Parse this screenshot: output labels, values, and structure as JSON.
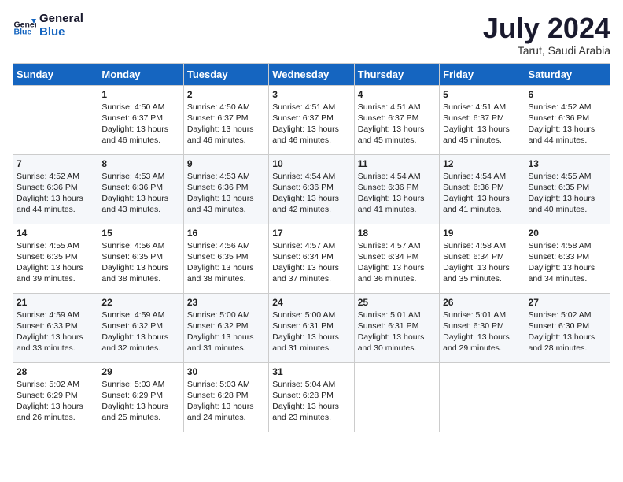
{
  "header": {
    "logo_line1": "General",
    "logo_line2": "Blue",
    "month": "July 2024",
    "location": "Tarut, Saudi Arabia"
  },
  "days_of_week": [
    "Sunday",
    "Monday",
    "Tuesday",
    "Wednesday",
    "Thursday",
    "Friday",
    "Saturday"
  ],
  "weeks": [
    [
      {
        "day": "",
        "content": ""
      },
      {
        "day": "1",
        "content": "Sunrise: 4:50 AM\nSunset: 6:37 PM\nDaylight: 13 hours\nand 46 minutes."
      },
      {
        "day": "2",
        "content": "Sunrise: 4:50 AM\nSunset: 6:37 PM\nDaylight: 13 hours\nand 46 minutes."
      },
      {
        "day": "3",
        "content": "Sunrise: 4:51 AM\nSunset: 6:37 PM\nDaylight: 13 hours\nand 46 minutes."
      },
      {
        "day": "4",
        "content": "Sunrise: 4:51 AM\nSunset: 6:37 PM\nDaylight: 13 hours\nand 45 minutes."
      },
      {
        "day": "5",
        "content": "Sunrise: 4:51 AM\nSunset: 6:37 PM\nDaylight: 13 hours\nand 45 minutes."
      },
      {
        "day": "6",
        "content": "Sunrise: 4:52 AM\nSunset: 6:36 PM\nDaylight: 13 hours\nand 44 minutes."
      }
    ],
    [
      {
        "day": "7",
        "content": "Sunrise: 4:52 AM\nSunset: 6:36 PM\nDaylight: 13 hours\nand 44 minutes."
      },
      {
        "day": "8",
        "content": "Sunrise: 4:53 AM\nSunset: 6:36 PM\nDaylight: 13 hours\nand 43 minutes."
      },
      {
        "day": "9",
        "content": "Sunrise: 4:53 AM\nSunset: 6:36 PM\nDaylight: 13 hours\nand 43 minutes."
      },
      {
        "day": "10",
        "content": "Sunrise: 4:54 AM\nSunset: 6:36 PM\nDaylight: 13 hours\nand 42 minutes."
      },
      {
        "day": "11",
        "content": "Sunrise: 4:54 AM\nSunset: 6:36 PM\nDaylight: 13 hours\nand 41 minutes."
      },
      {
        "day": "12",
        "content": "Sunrise: 4:54 AM\nSunset: 6:36 PM\nDaylight: 13 hours\nand 41 minutes."
      },
      {
        "day": "13",
        "content": "Sunrise: 4:55 AM\nSunset: 6:35 PM\nDaylight: 13 hours\nand 40 minutes."
      }
    ],
    [
      {
        "day": "14",
        "content": "Sunrise: 4:55 AM\nSunset: 6:35 PM\nDaylight: 13 hours\nand 39 minutes."
      },
      {
        "day": "15",
        "content": "Sunrise: 4:56 AM\nSunset: 6:35 PM\nDaylight: 13 hours\nand 38 minutes."
      },
      {
        "day": "16",
        "content": "Sunrise: 4:56 AM\nSunset: 6:35 PM\nDaylight: 13 hours\nand 38 minutes."
      },
      {
        "day": "17",
        "content": "Sunrise: 4:57 AM\nSunset: 6:34 PM\nDaylight: 13 hours\nand 37 minutes."
      },
      {
        "day": "18",
        "content": "Sunrise: 4:57 AM\nSunset: 6:34 PM\nDaylight: 13 hours\nand 36 minutes."
      },
      {
        "day": "19",
        "content": "Sunrise: 4:58 AM\nSunset: 6:34 PM\nDaylight: 13 hours\nand 35 minutes."
      },
      {
        "day": "20",
        "content": "Sunrise: 4:58 AM\nSunset: 6:33 PM\nDaylight: 13 hours\nand 34 minutes."
      }
    ],
    [
      {
        "day": "21",
        "content": "Sunrise: 4:59 AM\nSunset: 6:33 PM\nDaylight: 13 hours\nand 33 minutes."
      },
      {
        "day": "22",
        "content": "Sunrise: 4:59 AM\nSunset: 6:32 PM\nDaylight: 13 hours\nand 32 minutes."
      },
      {
        "day": "23",
        "content": "Sunrise: 5:00 AM\nSunset: 6:32 PM\nDaylight: 13 hours\nand 31 minutes."
      },
      {
        "day": "24",
        "content": "Sunrise: 5:00 AM\nSunset: 6:31 PM\nDaylight: 13 hours\nand 31 minutes."
      },
      {
        "day": "25",
        "content": "Sunrise: 5:01 AM\nSunset: 6:31 PM\nDaylight: 13 hours\nand 30 minutes."
      },
      {
        "day": "26",
        "content": "Sunrise: 5:01 AM\nSunset: 6:30 PM\nDaylight: 13 hours\nand 29 minutes."
      },
      {
        "day": "27",
        "content": "Sunrise: 5:02 AM\nSunset: 6:30 PM\nDaylight: 13 hours\nand 28 minutes."
      }
    ],
    [
      {
        "day": "28",
        "content": "Sunrise: 5:02 AM\nSunset: 6:29 PM\nDaylight: 13 hours\nand 26 minutes."
      },
      {
        "day": "29",
        "content": "Sunrise: 5:03 AM\nSunset: 6:29 PM\nDaylight: 13 hours\nand 25 minutes."
      },
      {
        "day": "30",
        "content": "Sunrise: 5:03 AM\nSunset: 6:28 PM\nDaylight: 13 hours\nand 24 minutes."
      },
      {
        "day": "31",
        "content": "Sunrise: 5:04 AM\nSunset: 6:28 PM\nDaylight: 13 hours\nand 23 minutes."
      },
      {
        "day": "",
        "content": ""
      },
      {
        "day": "",
        "content": ""
      },
      {
        "day": "",
        "content": ""
      }
    ]
  ]
}
